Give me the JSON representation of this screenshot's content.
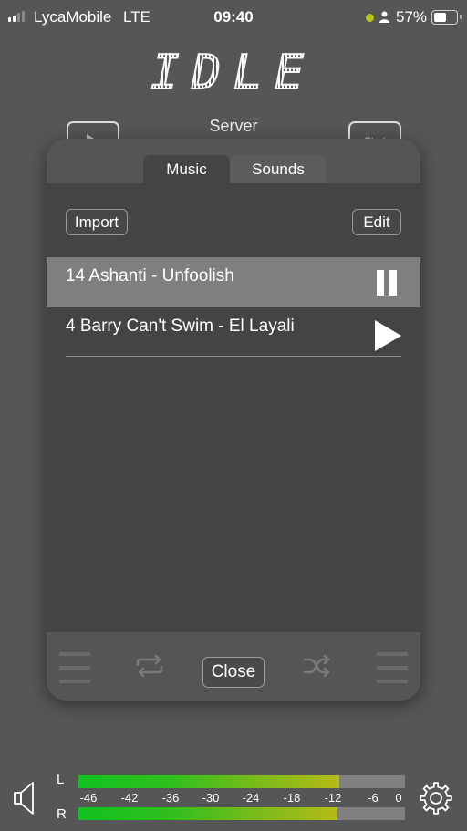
{
  "status_bar": {
    "signal_bars_active": 2,
    "signal_bars_total": 4,
    "carrier": "LycaMobile",
    "network": "LTE",
    "time": "09:40",
    "mic_indicator_color": "#b5c318",
    "battery_percent_label": "57%",
    "battery_level": 0.57
  },
  "header": {
    "status_display": "IDLE",
    "server_label": "Server",
    "left_button_icon": "play-icon",
    "right_button_label": "Start"
  },
  "panel": {
    "tabs": [
      {
        "label": "Music",
        "active": true
      },
      {
        "label": "Sounds",
        "active": false
      }
    ],
    "import_label": "Import",
    "edit_label": "Edit",
    "tracks": [
      {
        "title": "14 Ashanti - Unfoolish",
        "state": "playing",
        "icon": "pause-icon"
      },
      {
        "title": "4 Barry Can't Swim - El Layali",
        "state": "stopped",
        "icon": "play-icon"
      }
    ],
    "footer": {
      "left_icon": "menu-lines-icon",
      "repeat_icon": "repeat-icon",
      "close_label": "Close",
      "shuffle_icon": "shuffle-icon",
      "right_icon": "menu-lines-icon"
    }
  },
  "meters": {
    "speaker_icon": "speaker-icon",
    "left_label": "L",
    "right_label": "R",
    "scale_ticks": [
      "-46",
      "-42",
      "-36",
      "-30",
      "-24",
      "-18",
      "-12",
      "-6",
      "0"
    ],
    "left_level_db": -11,
    "right_level_db": -11.3,
    "settings_icon": "gear-icon",
    "colors": {
      "low": "#12c220",
      "high": "#b5ba16",
      "empty": "#808080"
    }
  }
}
